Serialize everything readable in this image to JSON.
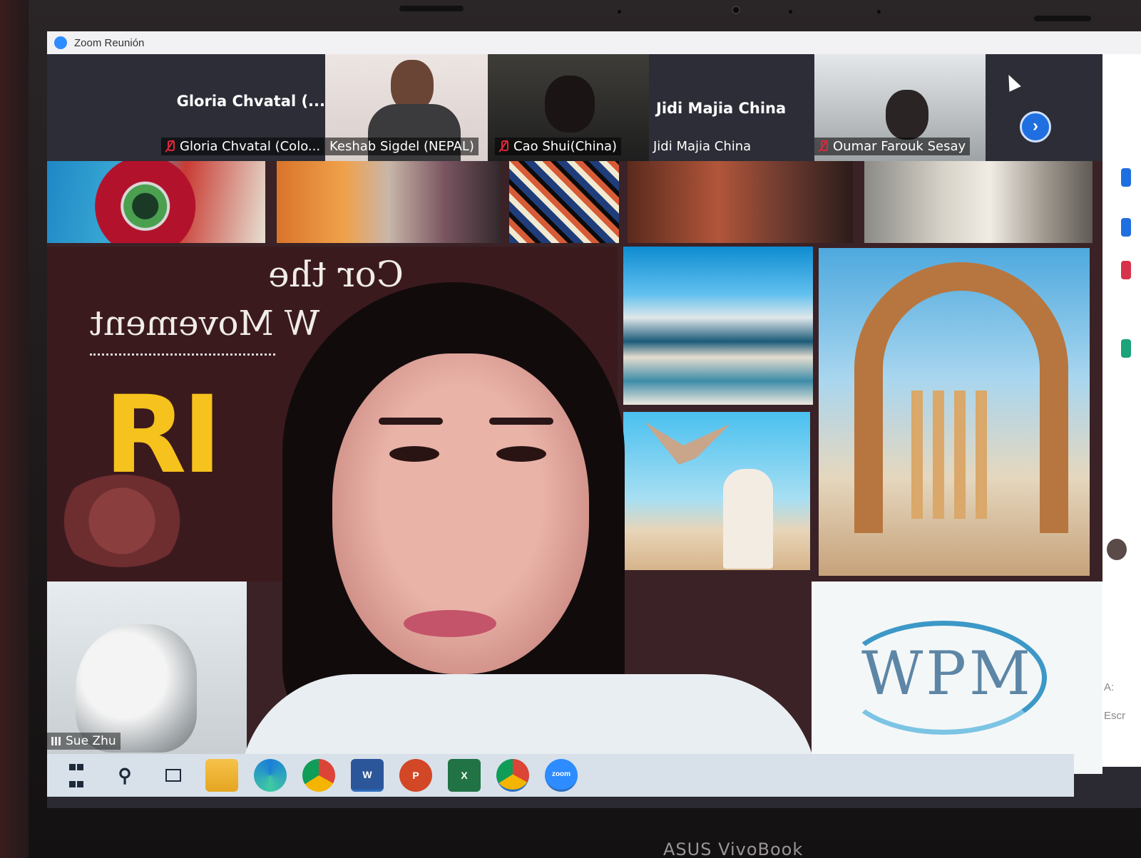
{
  "window": {
    "title": "Zoom Reunión"
  },
  "participants": [
    {
      "display_name": "Gloria Chvatal (...",
      "name_tag": "Gloria Chvatal (Colo...",
      "muted": true
    },
    {
      "name_tag": "Keshab Sigdel (NEPAL)",
      "muted": false
    },
    {
      "name_tag": "Cao Shui(China)",
      "muted": true
    },
    {
      "display_name": "Jidi Majia    China",
      "name_tag": "Jidi Majia    China",
      "muted": false
    },
    {
      "name_tag": "Oumar Farouk Sesay",
      "muted": true
    }
  ],
  "slide": {
    "mirrored_line1": "Cor   the",
    "mirrored_line2": "W   Movement",
    "big_letters": "RI",
    "logo_text": "WPM"
  },
  "active_speaker": {
    "name": "Sue Zhu"
  },
  "side_panel": {
    "to_label": "A:",
    "write_label": "Escr"
  },
  "taskbar": {
    "icons": [
      "windows-icon",
      "search-icon",
      "task-view-icon",
      "file-explorer-icon",
      "edge-icon",
      "chrome-icon",
      "word-icon",
      "powerpoint-icon",
      "excel-icon",
      "chrome-profile-icon",
      "zoom-icon"
    ],
    "zoom_label": "zoom",
    "word_label": "W",
    "ppt_label": "P",
    "excel_label": "X"
  },
  "device": {
    "brand": "ASUS VivoBook"
  },
  "colors": {
    "zoom_blue": "#2d8cff",
    "mute_red": "#e0263a",
    "slide_yellow": "#f6c21d",
    "slide_bg": "#3b1a1e"
  }
}
